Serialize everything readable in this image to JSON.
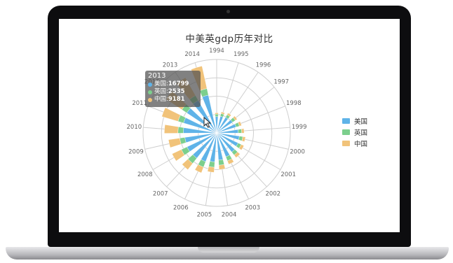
{
  "colors": {
    "us": "#5fb3e8",
    "uk": "#7ccf8d",
    "cn": "#f1c37a",
    "grid": "#cfcfcf",
    "axis_text": "#666666"
  },
  "chart_data": {
    "type": "bar",
    "coordinate_system": "polar",
    "stacked": true,
    "title": "中美英gdp历年对比",
    "categories": [
      "1994",
      "1995",
      "1996",
      "1997",
      "1998",
      "1999",
      "2000",
      "2001",
      "2002",
      "2003",
      "2004",
      "2005",
      "2006",
      "2007",
      "2008",
      "2009",
      "2010",
      "2011",
      "2012",
      "2013",
      "2014"
    ],
    "series": [
      {
        "name": "美国",
        "values": [
          7309,
          7664,
          8100,
          8609,
          9089,
          9661,
          10285,
          10622,
          10978,
          11511,
          12275,
          13094,
          13856,
          14478,
          14719,
          14419,
          14964,
          15518,
          16155,
          16799,
          17419
        ]
      },
      {
        "name": "英国",
        "values": [
          1141,
          1244,
          1318,
          1469,
          1542,
          1553,
          1548,
          1536,
          1680,
          1942,
          2292,
          2412,
          2630,
          2955,
          2792,
          2309,
          2407,
          2592,
          2615,
          2535,
          2990
        ]
      },
      {
        "name": "中国",
        "values": [
          564,
          734,
          863,
          961,
          1029,
          1094,
          1211,
          1339,
          1471,
          1660,
          1955,
          2286,
          2752,
          3552,
          4598,
          5110,
          6101,
          7573,
          8561,
          9181,
          10360
        ]
      }
    ],
    "radius_max": 33000,
    "radial_rings": 4,
    "grid": true,
    "legend_placement": "right",
    "tooltip": {
      "category": "2013",
      "rows": [
        {
          "label": "美国",
          "value": "16799"
        },
        {
          "label": "英国",
          "value": "2535"
        },
        {
          "label": "中国",
          "value": "9181"
        }
      ]
    }
  }
}
